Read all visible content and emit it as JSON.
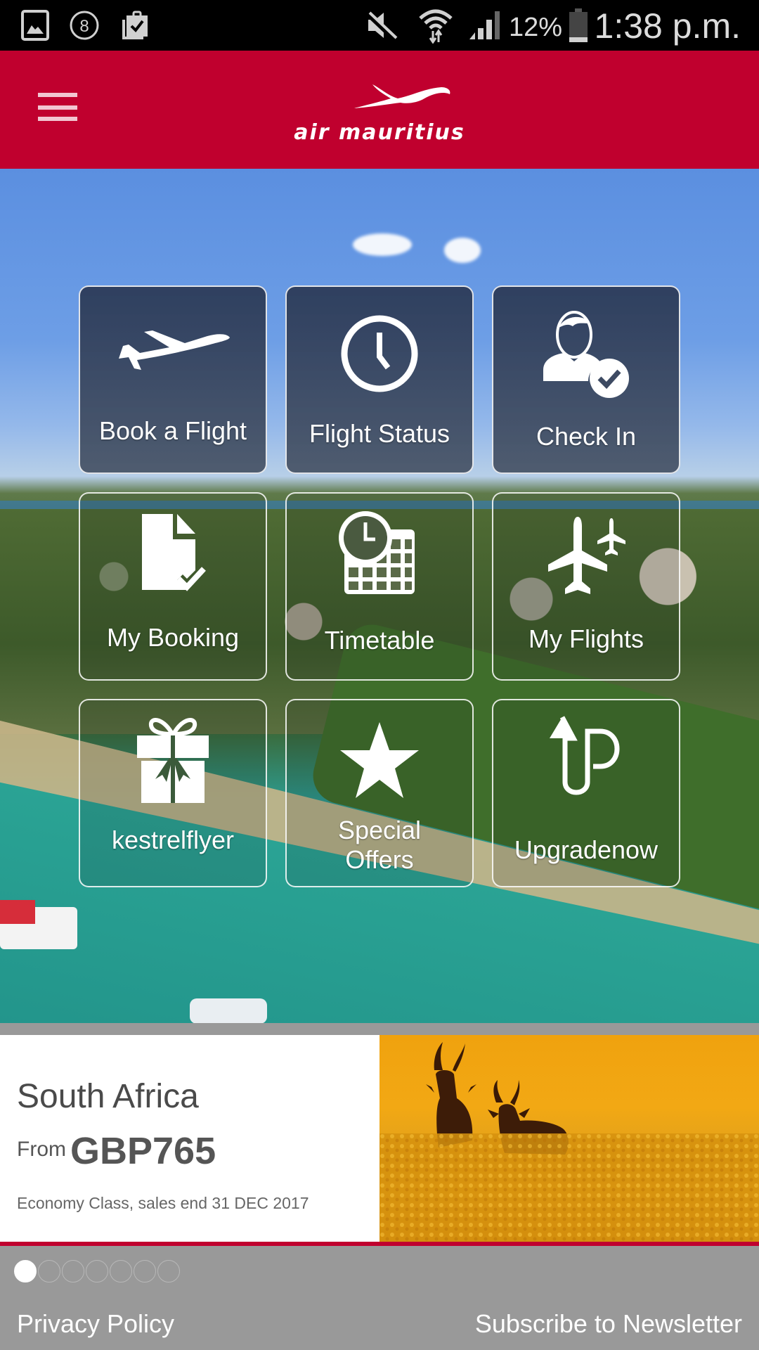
{
  "status_bar": {
    "left_icons": [
      "gallery-icon",
      "notification-8-icon",
      "clipboard-check-icon"
    ],
    "right_icons": [
      "mute-icon",
      "wifi-icon",
      "signal-icon",
      "battery-icon"
    ],
    "battery_percent": "12%",
    "time": "1:38 p.m."
  },
  "header": {
    "brand": "air mauritius",
    "menu_icon": "hamburger-menu-icon",
    "brand_color": "#c0002e"
  },
  "tiles": [
    {
      "label": "Book a Flight",
      "icon": "airplane-takeoff-icon"
    },
    {
      "label": "Flight Status",
      "icon": "clock-icon"
    },
    {
      "label": "Check In",
      "icon": "user-check-icon"
    },
    {
      "label": "My Booking",
      "icon": "document-check-icon"
    },
    {
      "label": "Timetable",
      "icon": "calendar-clock-icon"
    },
    {
      "label": "My Flights",
      "icon": "airplanes-icon"
    },
    {
      "label": "kestrelflyer",
      "icon": "gift-icon"
    },
    {
      "label": "Special Offers",
      "icon": "star-icon"
    },
    {
      "label": "Upgradenow",
      "icon": "upgrade-up-icon"
    }
  ],
  "promo": {
    "destination": "South Africa",
    "from_label": "From",
    "price": "GBP765",
    "note": "Economy Class, sales end 31 DEC 2017",
    "image": "antelopes-in-golden-grass"
  },
  "carousel": {
    "total_pages": 7,
    "active_page": 1
  },
  "footer": {
    "privacy": "Privacy Policy",
    "newsletter": "Subscribe to Newsletter"
  }
}
